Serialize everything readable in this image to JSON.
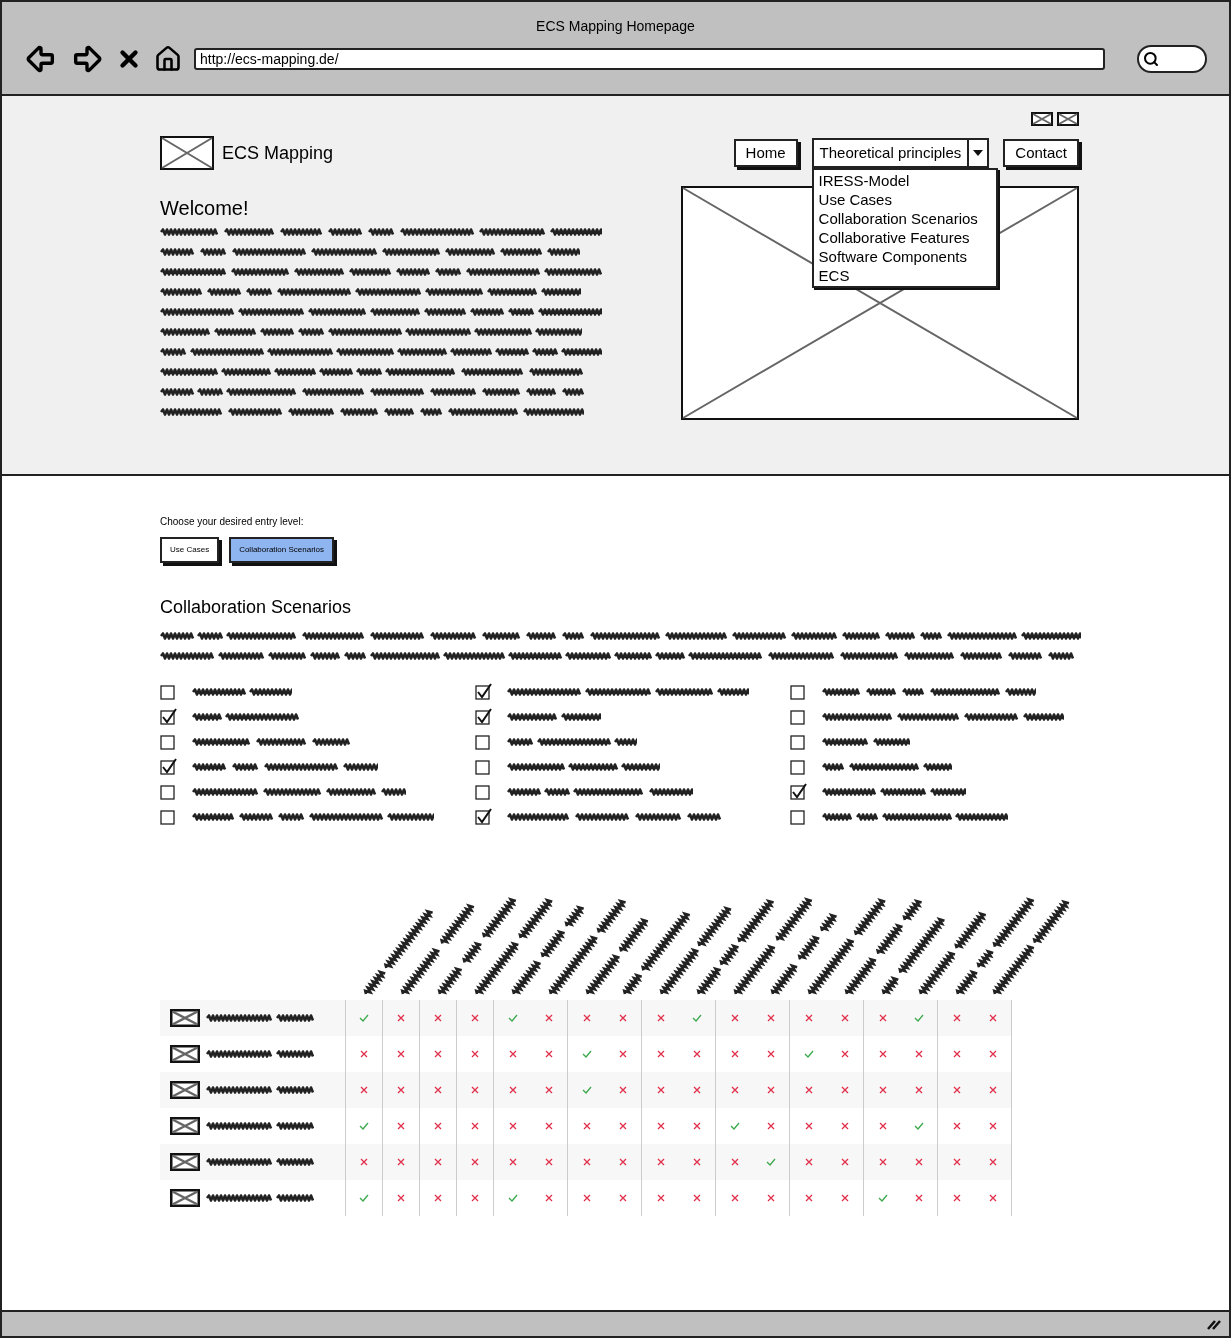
{
  "browser": {
    "title": "ECS Mapping Homepage",
    "url": "http://ecs-mapping.de/"
  },
  "site": {
    "logo_text": "ECS Mapping",
    "welcome_title": "Welcome!",
    "nav": [
      {
        "kind": "button",
        "label": "Home"
      },
      {
        "kind": "dropdown",
        "label": "Theoretical principles",
        "expanded": true,
        "menu": [
          "IRESS-Model",
          "Use Cases",
          "Collaboration Scenarios",
          "Collaborative Features",
          "Software Components",
          "ECS"
        ]
      },
      {
        "kind": "button",
        "label": "Contact"
      }
    ]
  },
  "entry": {
    "prompt": "Choose your desired entry level:",
    "options": [
      {
        "label": "Use Cases",
        "selected": false
      },
      {
        "label": "Collaboration Scenarios",
        "selected": true
      }
    ]
  },
  "section_title": "Collaboration Scenarios",
  "checkbox_columns": [
    [
      {
        "checked": false
      },
      {
        "checked": true
      },
      {
        "checked": false
      },
      {
        "checked": true
      },
      {
        "checked": false
      },
      {
        "checked": false
      }
    ],
    [
      {
        "checked": true
      },
      {
        "checked": true
      },
      {
        "checked": false
      },
      {
        "checked": false
      },
      {
        "checked": false
      },
      {
        "checked": true
      }
    ],
    [
      {
        "checked": false
      },
      {
        "checked": false
      },
      {
        "checked": false
      },
      {
        "checked": false
      },
      {
        "checked": true
      },
      {
        "checked": false
      }
    ]
  ],
  "matrix": {
    "rows": [
      {
        "cells": [
          {
            "match": true
          },
          {
            "match": false
          },
          {
            "match": false
          },
          {
            "match": false
          },
          {
            "match": true
          },
          {
            "match": false
          },
          {
            "match": false
          },
          {
            "match": false
          },
          {
            "match": false
          },
          {
            "match": true
          },
          {
            "match": false
          },
          {
            "match": false
          },
          {
            "match": false
          },
          {
            "match": false
          },
          {
            "match": false
          },
          {
            "match": true
          },
          {
            "match": false
          },
          {
            "match": false
          }
        ]
      },
      {
        "cells": [
          {
            "match": false
          },
          {
            "match": false
          },
          {
            "match": false
          },
          {
            "match": false
          },
          {
            "match": false
          },
          {
            "match": false
          },
          {
            "match": true
          },
          {
            "match": false
          },
          {
            "match": false
          },
          {
            "match": false
          },
          {
            "match": false
          },
          {
            "match": false
          },
          {
            "match": true
          },
          {
            "match": false
          },
          {
            "match": false
          },
          {
            "match": false
          },
          {
            "match": false
          },
          {
            "match": false
          }
        ]
      },
      {
        "cells": [
          {
            "match": false
          },
          {
            "match": false
          },
          {
            "match": false
          },
          {
            "match": false
          },
          {
            "match": false
          },
          {
            "match": false
          },
          {
            "match": true
          },
          {
            "match": false
          },
          {
            "match": false
          },
          {
            "match": false
          },
          {
            "match": false
          },
          {
            "match": false
          },
          {
            "match": false
          },
          {
            "match": false
          },
          {
            "match": false
          },
          {
            "match": false
          },
          {
            "match": false
          },
          {
            "match": false
          }
        ]
      },
      {
        "cells": [
          {
            "match": true
          },
          {
            "match": false
          },
          {
            "match": false
          },
          {
            "match": false
          },
          {
            "match": false
          },
          {
            "match": false
          },
          {
            "match": false
          },
          {
            "match": false
          },
          {
            "match": false
          },
          {
            "match": false
          },
          {
            "match": true
          },
          {
            "match": false
          },
          {
            "match": false
          },
          {
            "match": false
          },
          {
            "match": false
          },
          {
            "match": true
          },
          {
            "match": false
          },
          {
            "match": false
          }
        ]
      },
      {
        "cells": [
          {
            "match": false
          },
          {
            "match": false
          },
          {
            "match": false
          },
          {
            "match": false
          },
          {
            "match": false
          },
          {
            "match": false
          },
          {
            "match": false
          },
          {
            "match": false
          },
          {
            "match": false
          },
          {
            "match": false
          },
          {
            "match": false
          },
          {
            "match": true
          },
          {
            "match": false
          },
          {
            "match": false
          },
          {
            "match": false
          },
          {
            "match": false
          },
          {
            "match": false
          },
          {
            "match": false
          }
        ]
      },
      {
        "cells": [
          {
            "match": true
          },
          {
            "match": false
          },
          {
            "match": false
          },
          {
            "match": false
          },
          {
            "match": true
          },
          {
            "match": false
          },
          {
            "match": false
          },
          {
            "match": false
          },
          {
            "match": false
          },
          {
            "match": false
          },
          {
            "match": false
          },
          {
            "match": false
          },
          {
            "match": false
          },
          {
            "match": false
          },
          {
            "match": true
          },
          {
            "match": false
          },
          {
            "match": false
          },
          {
            "match": false
          }
        ]
      }
    ]
  }
}
